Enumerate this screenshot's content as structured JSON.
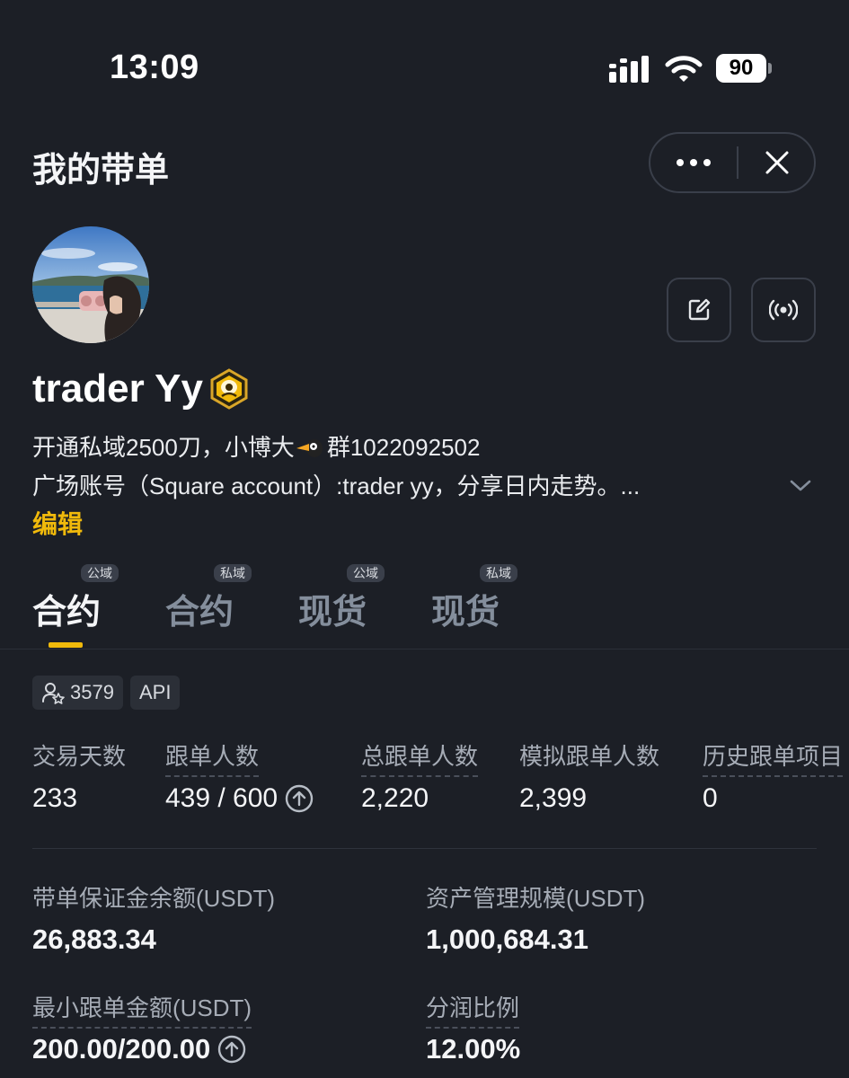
{
  "status_bar": {
    "time": "13:09",
    "battery": "90"
  },
  "header": {
    "title": "我的带单"
  },
  "profile": {
    "name": "trader Yy",
    "bio_line1_a": "开通私域2500刀，小博大",
    "bio_line1_b": "群1022092502",
    "bio_line2": "广场账号（Square account）:trader yy，分享日内走势。...",
    "edit_label": "编辑"
  },
  "tabs": [
    {
      "label": "合约",
      "tag": "公域"
    },
    {
      "label": "合约",
      "tag": "私域"
    },
    {
      "label": "现货",
      "tag": "公域"
    },
    {
      "label": "现货",
      "tag": "私域"
    }
  ],
  "chips": {
    "followers": "3579",
    "api": "API"
  },
  "stats": [
    {
      "label": "交易天数",
      "value": "233"
    },
    {
      "label": "跟单人数",
      "value": "439 / 600"
    },
    {
      "label": "总跟单人数",
      "value": "2,220"
    },
    {
      "label": "模拟跟单人数",
      "value": "2,399"
    },
    {
      "label": "历史跟单项目",
      "value": "0"
    }
  ],
  "details": {
    "margin_label": "带单保证金余额(USDT)",
    "margin_value": "26,883.34",
    "aum_label": "资产管理规模(USDT)",
    "aum_value": "1,000,684.31",
    "min_label": "最小跟单金额(USDT)",
    "min_value": "200.00/200.00",
    "profit_label": "分润比例",
    "profit_value": "12.00%"
  },
  "colors": {
    "background": "#1c1f26",
    "accent": "#f0b90b",
    "muted": "#a6acb6"
  },
  "icons": [
    "signal-icon",
    "wifi-icon",
    "more-dots-icon",
    "close-icon",
    "edit-square-icon",
    "live-broadcast-icon",
    "verified-badge-icon",
    "chevron-down-icon",
    "user-star-icon",
    "arrow-up-circle-icon"
  ]
}
